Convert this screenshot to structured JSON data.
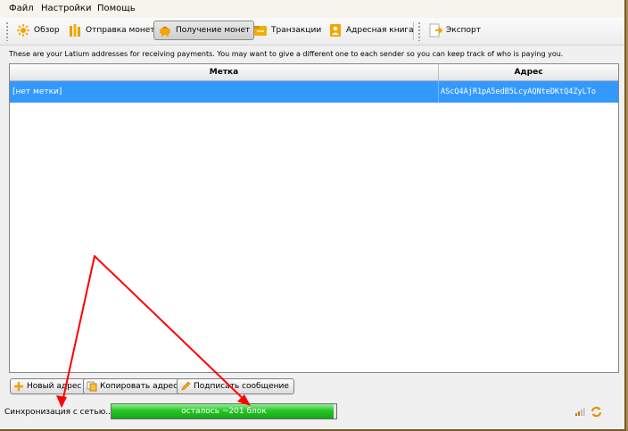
{
  "menu": {
    "file": "Файл",
    "settings": "Настройки",
    "help": "Помощь"
  },
  "toolbar": {
    "overview": "Обзор",
    "send": "Отправка монет",
    "receive": "Получение монет",
    "transactions": "Транзакции",
    "addressbook": "Адресная книга",
    "export": "Экспорт"
  },
  "description": "These are your Latium addresses for receiving payments. You may want to give a different one to each sender so you can keep track of who is paying you.",
  "table": {
    "columns": [
      "Метка",
      "Адрес"
    ],
    "rows": [
      {
        "label": "[нет метки]",
        "address": "AScQ4AjR1pA5edB5LcyAQNteDKtQ4ZyLTo"
      }
    ]
  },
  "buttons": {
    "new_address": "Новый адрес",
    "copy_address": "Копировать адрес",
    "sign_message": "Подписать сообщение"
  },
  "status": {
    "sync_label": "Синхронизация с сетью...",
    "progress_text": "осталось ~201 блок",
    "progress_fraction": 0.99
  },
  "colors": {
    "selection": "#3399ff",
    "progress": "#27c427",
    "annotation": "#ff0000"
  }
}
